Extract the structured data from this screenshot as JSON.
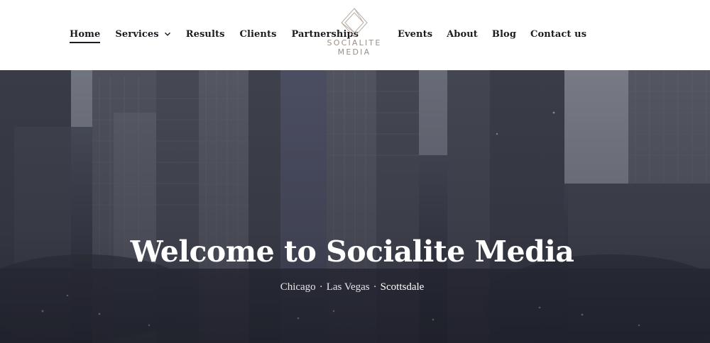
{
  "nav": {
    "left": [
      {
        "label": "Home"
      },
      {
        "label": "Services"
      },
      {
        "label": "Results"
      },
      {
        "label": "Clients"
      },
      {
        "label": "Partnerships"
      }
    ],
    "right": [
      {
        "label": "Events"
      },
      {
        "label": "About"
      },
      {
        "label": "Blog"
      },
      {
        "label": "Contact us"
      }
    ],
    "active": "Home"
  },
  "logo": {
    "line1": "SOCIALITE",
    "line2": "MEDIA",
    "color": "#9c8f86"
  },
  "hero": {
    "title": "Welcome to Socialite Media",
    "locations": [
      "Chicago",
      "Las Vegas",
      "Scottsdale"
    ],
    "separator": "·"
  },
  "colors": {
    "text": "#1b1b22",
    "hero_text": "#ffffff"
  }
}
